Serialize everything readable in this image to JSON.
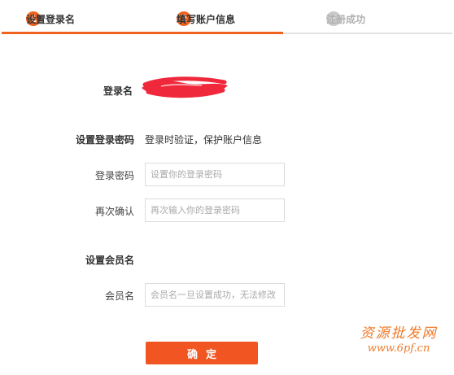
{
  "steps": [
    {
      "number": "1",
      "label": "设置登录名",
      "state": "active"
    },
    {
      "number": "2",
      "label": "填写账户信息",
      "state": "active"
    },
    {
      "number": "✓",
      "label": "注册成功",
      "state": "done"
    }
  ],
  "login_name": {
    "label": "登录名"
  },
  "password_section": {
    "title": "设置登录密码",
    "hint": "登录时验证，保护账户信息",
    "password_label": "登录密码",
    "password_placeholder": "设置你的登录密码",
    "confirm_label": "再次确认",
    "confirm_placeholder": "再次输入你的登录密码"
  },
  "member_section": {
    "title": "设置会员名",
    "member_label": "会员名",
    "member_placeholder": "会员名一旦设置成功，无法修改"
  },
  "submit_label": "确定",
  "watermark": {
    "line1": "资源批发网",
    "line2": "www.6pf.cn"
  },
  "colors": {
    "accent": "#f2621f",
    "button": "#f05522",
    "done_grey": "#c9c9c9",
    "redaction": "#f0283c"
  }
}
